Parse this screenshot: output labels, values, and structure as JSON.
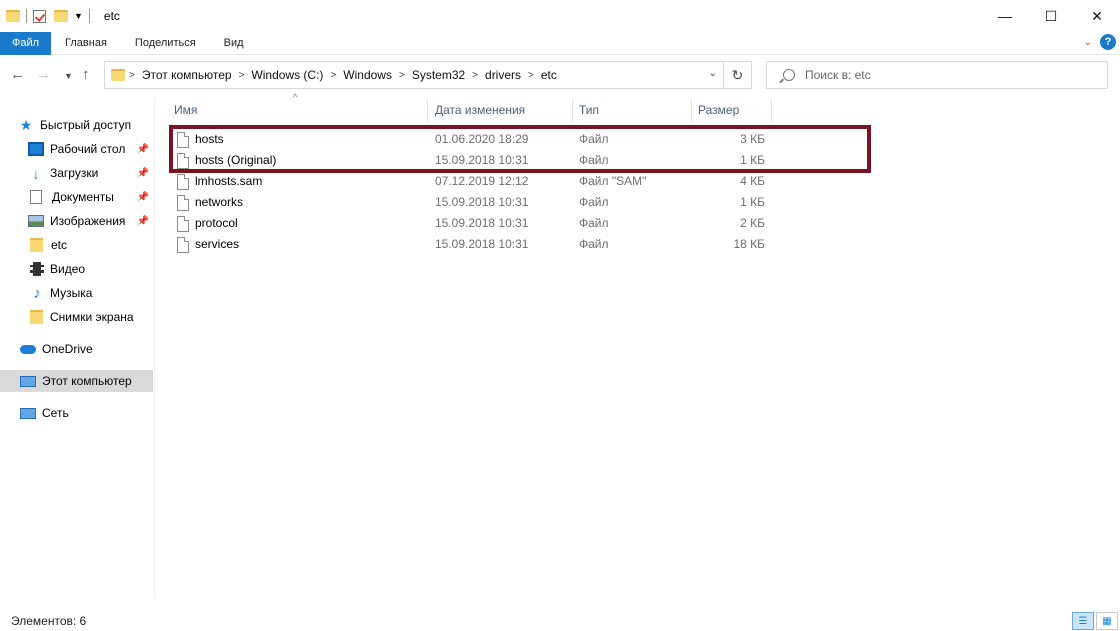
{
  "window": {
    "title": "etc",
    "minimize": "—",
    "maximize": "☐",
    "close": "✕"
  },
  "ribbon": {
    "tabs": [
      "Файл",
      "Главная",
      "Поделиться",
      "Вид"
    ],
    "help": "?"
  },
  "address": {
    "crumbs": [
      "Этот компьютер",
      "Windows (C:)",
      "Windows",
      "System32",
      "drivers",
      "etc"
    ],
    "separator": ">"
  },
  "search": {
    "placeholder": "Поиск в: etc"
  },
  "sidebar": {
    "items": [
      {
        "label": "Быстрый доступ",
        "icon": "star-icon"
      },
      {
        "label": "Рабочий стол",
        "icon": "desktop-icon",
        "pinned": true
      },
      {
        "label": "Загрузки",
        "icon": "download-icon",
        "pinned": true
      },
      {
        "label": "Документы",
        "icon": "documents-icon",
        "pinned": true
      },
      {
        "label": "Изображения",
        "icon": "pictures-icon",
        "pinned": true
      },
      {
        "label": "etc",
        "icon": "folder-icon"
      },
      {
        "label": "Видео",
        "icon": "video-icon"
      },
      {
        "label": "Музыка",
        "icon": "music-icon"
      },
      {
        "label": "Снимки экрана",
        "icon": "folder-icon"
      },
      {
        "label": "OneDrive",
        "icon": "cloud-icon"
      },
      {
        "label": "Этот компьютер",
        "icon": "computer-icon",
        "selected": true
      },
      {
        "label": "Сеть",
        "icon": "network-icon"
      }
    ]
  },
  "columns": {
    "name": "Имя",
    "date": "Дата изменения",
    "type": "Тип",
    "size": "Размер"
  },
  "files": [
    {
      "name": "hosts",
      "date": "01.06.2020 18:29",
      "type": "Файл",
      "size": "3 КБ"
    },
    {
      "name": "hosts (Original)",
      "date": "15.09.2018 10:31",
      "type": "Файл",
      "size": "1 КБ"
    },
    {
      "name": "lmhosts.sam",
      "date": "07.12.2019 12:12",
      "type": "Файл \"SAM\"",
      "size": "4 КБ"
    },
    {
      "name": "networks",
      "date": "15.09.2018 10:31",
      "type": "Файл",
      "size": "1 КБ"
    },
    {
      "name": "protocol",
      "date": "15.09.2018 10:31",
      "type": "Файл",
      "size": "2 КБ"
    },
    {
      "name": "services",
      "date": "15.09.2018 10:31",
      "type": "Файл",
      "size": "18 КБ"
    }
  ],
  "status": {
    "items_text": "Элементов: 6"
  },
  "colors": {
    "accent": "#1979ca",
    "highlight_border": "#7a1424"
  }
}
